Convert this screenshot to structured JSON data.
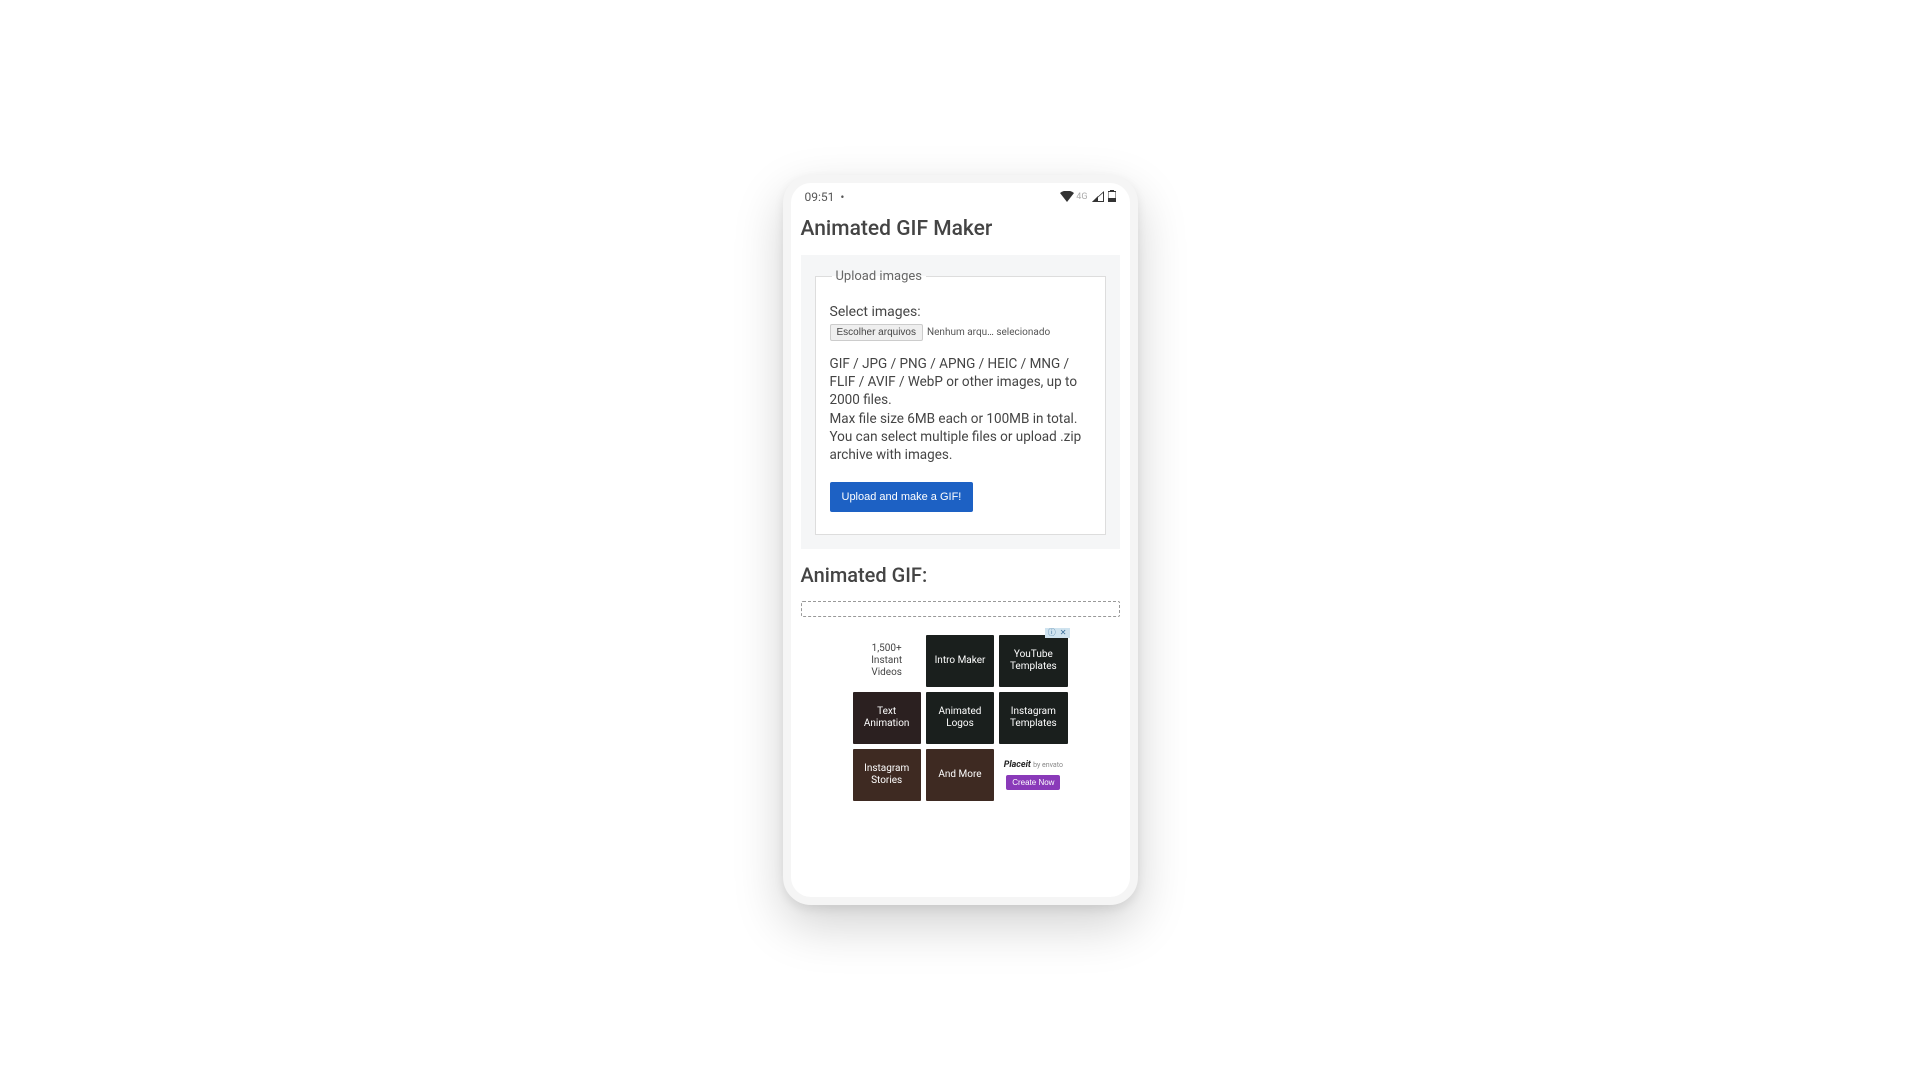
{
  "status": {
    "time": "09:51",
    "network": "4G"
  },
  "page": {
    "title": "Animated GIF Maker"
  },
  "upload": {
    "legend": "Upload images",
    "select_label": "Select images:",
    "choose_btn": "Escolher arquivos",
    "no_file": "Nenhum arqu… selecionado",
    "formats": "GIF / JPG / PNG / APNG / HEIC / MNG / FLIF / AVIF / WebP or other images, up to 2000 files.",
    "limits": "Max file size 6MB each or 100MB in total.",
    "multi": "You can select multiple files or upload .zip archive with images.",
    "submit": "Upload and make a GIF!"
  },
  "result": {
    "title": "Animated GIF:"
  },
  "ad": {
    "tiles": {
      "t0": "1,500+ Instant Videos",
      "t1": "Intro Maker",
      "t2": "YouTube Templates",
      "t3": "Text Animation",
      "t4": "Animated Logos",
      "t5": "Instagram Templates",
      "t6": "Instagram Stories",
      "t7": "And More"
    },
    "brand": "Placeit",
    "brand_by": "by envato",
    "cta": "Create Now"
  }
}
